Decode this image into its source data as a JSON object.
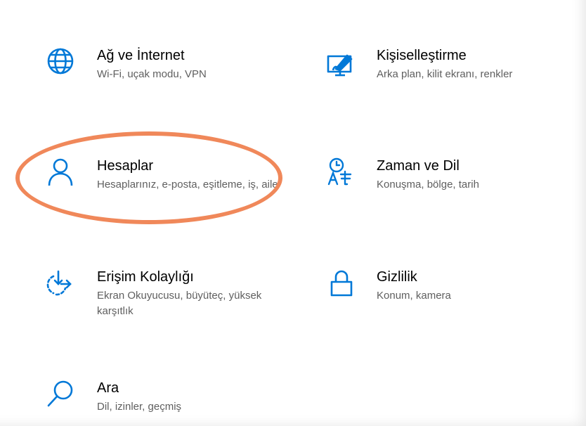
{
  "settings": {
    "items": [
      {
        "id": "network",
        "icon": "globe-icon",
        "title": "Ağ ve İnternet",
        "description": "Wi-Fi, uçak modu, VPN"
      },
      {
        "id": "personalization",
        "icon": "personalization-icon",
        "title": "Kişiselleştirme",
        "description": "Arka plan, kilit ekranı, renkler"
      },
      {
        "id": "accounts",
        "icon": "person-icon",
        "title": "Hesaplar",
        "description": "Hesaplarınız, e-posta, eşitleme, iş, aile"
      },
      {
        "id": "time-language",
        "icon": "time-language-icon",
        "title": "Zaman ve Dil",
        "description": "Konuşma, bölge, tarih"
      },
      {
        "id": "ease-of-access",
        "icon": "ease-of-access-icon",
        "title": "Erişim Kolaylığı",
        "description": "Ekran Okuyucusu, büyüteç, yüksek karşıtlık"
      },
      {
        "id": "privacy",
        "icon": "lock-icon",
        "title": "Gizlilik",
        "description": "Konum, kamera"
      },
      {
        "id": "search",
        "icon": "search-icon",
        "title": "Ara",
        "description": "Dil, izinler, geçmiş"
      }
    ]
  },
  "colors": {
    "accent": "#0078d7",
    "highlight": "#f0885a"
  }
}
